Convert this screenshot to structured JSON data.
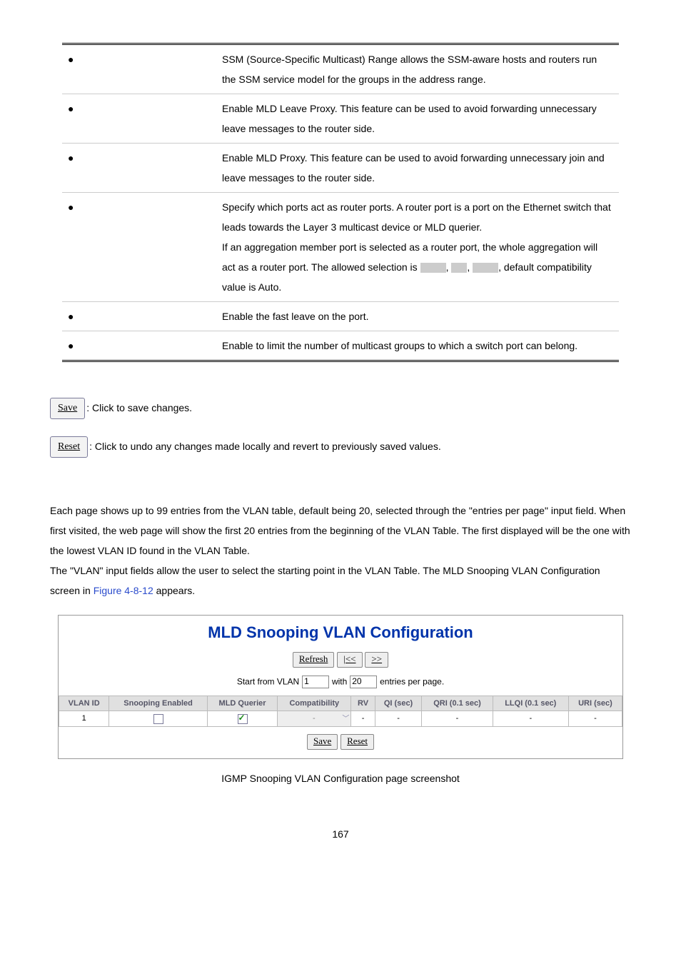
{
  "params": [
    {
      "desc": "SSM (Source-Specific Multicast) Range allows the SSM-aware hosts and routers run the SSM service model for the groups in the address range."
    },
    {
      "desc": "Enable MLD Leave Proxy. This feature can be used to avoid forwarding unnecessary leave messages to the router side."
    },
    {
      "desc": "Enable MLD Proxy. This feature can be used to avoid forwarding unnecessary join and leave messages to the router side."
    },
    {
      "desc": "Specify which ports act as router ports. A router port is a port on the Ethernet switch that leads towards the Layer 3 multicast device or MLD querier.",
      "desc2_pre": "If an aggregation member port is selected as a router port, the whole aggregation will act as a router port. The allowed selection is ",
      "desc2_post": ", default compatibility value is Auto."
    },
    {
      "desc": "Enable the fast leave on the port."
    },
    {
      "desc": "Enable to limit the number of multicast groups to which a switch port can belong."
    }
  ],
  "saveBtn": "Save",
  "saveText": ": Click to save changes.",
  "resetBtn": "Reset",
  "resetText": ": Click to undo any changes made locally and revert to previously saved values.",
  "bodyText1": "Each page shows up to 99 entries from the VLAN table, default being 20, selected through the \"entries per page\" input field. When first visited, the web page will show the first 20 entries from the beginning of the VLAN Table. The first displayed will be the one with the lowest VLAN ID found in the VLAN Table.",
  "bodyText2a": "The \"VLAN\" input fields allow the user to select the starting point in the VLAN Table. The MLD Snooping VLAN Configuration screen in ",
  "figLink": "Figure 4-8-12",
  "bodyText2b": " appears.",
  "screenshot": {
    "title": "MLD Snooping VLAN Configuration",
    "refreshBtn": "Refresh",
    "firstBtn": "|<<",
    "nextBtn": ">>",
    "startLabel": "Start from VLAN",
    "startValue": "1",
    "withLabel": "with",
    "withValue": "20",
    "entriesLabel": "entries per page.",
    "headers": [
      "VLAN ID",
      "Snooping Enabled",
      "MLD Querier",
      "Compatibility",
      "RV",
      "QI (sec)",
      "QRI (0.1 sec)",
      "LLQI (0.1 sec)",
      "URI (sec)"
    ],
    "row": {
      "vlan": "1",
      "compat": "-",
      "rv": "-",
      "qi": "-",
      "qri": "-",
      "llqi": "-",
      "uri": "-"
    },
    "saveBtn": "Save",
    "resetBtn": "Reset"
  },
  "caption": "IGMP Snooping VLAN Configuration page screenshot",
  "pageNum": "167"
}
